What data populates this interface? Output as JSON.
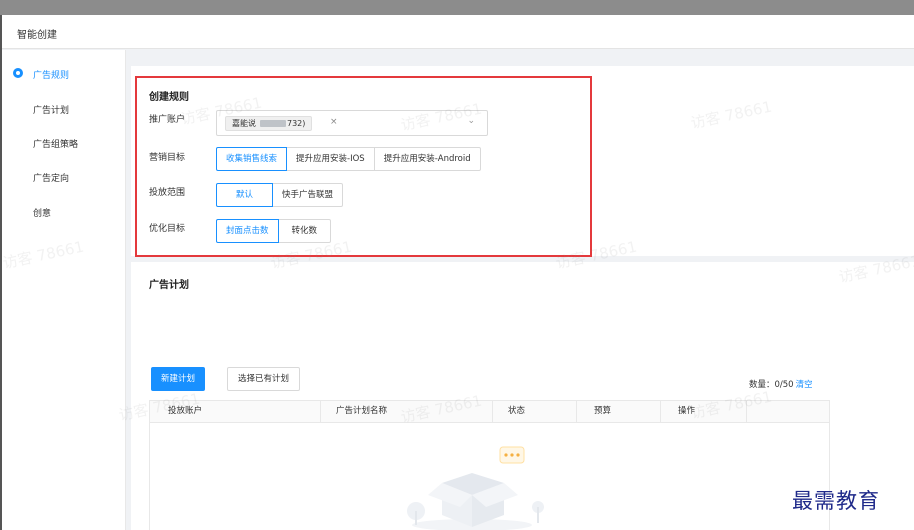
{
  "header": {
    "title": "智能创建"
  },
  "sidebar": {
    "items": [
      {
        "label": "广告规则",
        "active": true
      },
      {
        "label": "广告计划",
        "active": false
      },
      {
        "label": "广告组策略",
        "active": false
      },
      {
        "label": "广告定向",
        "active": false
      },
      {
        "label": "创意",
        "active": false
      }
    ]
  },
  "rules": {
    "title": "创建规则",
    "account": {
      "label": "推广账户",
      "tag_prefix": "嘉能说",
      "tag_suffix": "732)",
      "remove_icon": "×"
    },
    "goal": {
      "label": "营销目标",
      "options": [
        "收集销售线索",
        "提升应用安装-IOS",
        "提升应用安装-Android"
      ],
      "selected": 0
    },
    "scope": {
      "label": "投放范围",
      "options": [
        "默认",
        "快手广告联盟"
      ],
      "selected": 0
    },
    "optimize": {
      "label": "优化目标",
      "options": [
        "封面点击数",
        "转化数"
      ],
      "selected": 0
    }
  },
  "plans": {
    "title": "广告计划",
    "new_button": "新建计划",
    "select_button": "选择已有计划",
    "count_label": "数量：0/50",
    "clear_link": "清空",
    "columns": [
      "投放账户",
      "广告计划名称",
      "状态",
      "预算",
      "操作"
    ]
  },
  "watermark": "访客 78661",
  "brand": "最需教育",
  "colors": {
    "primary": "#1890ff",
    "highlight_border": "#e4393c",
    "brand": "#1f2a8a"
  }
}
